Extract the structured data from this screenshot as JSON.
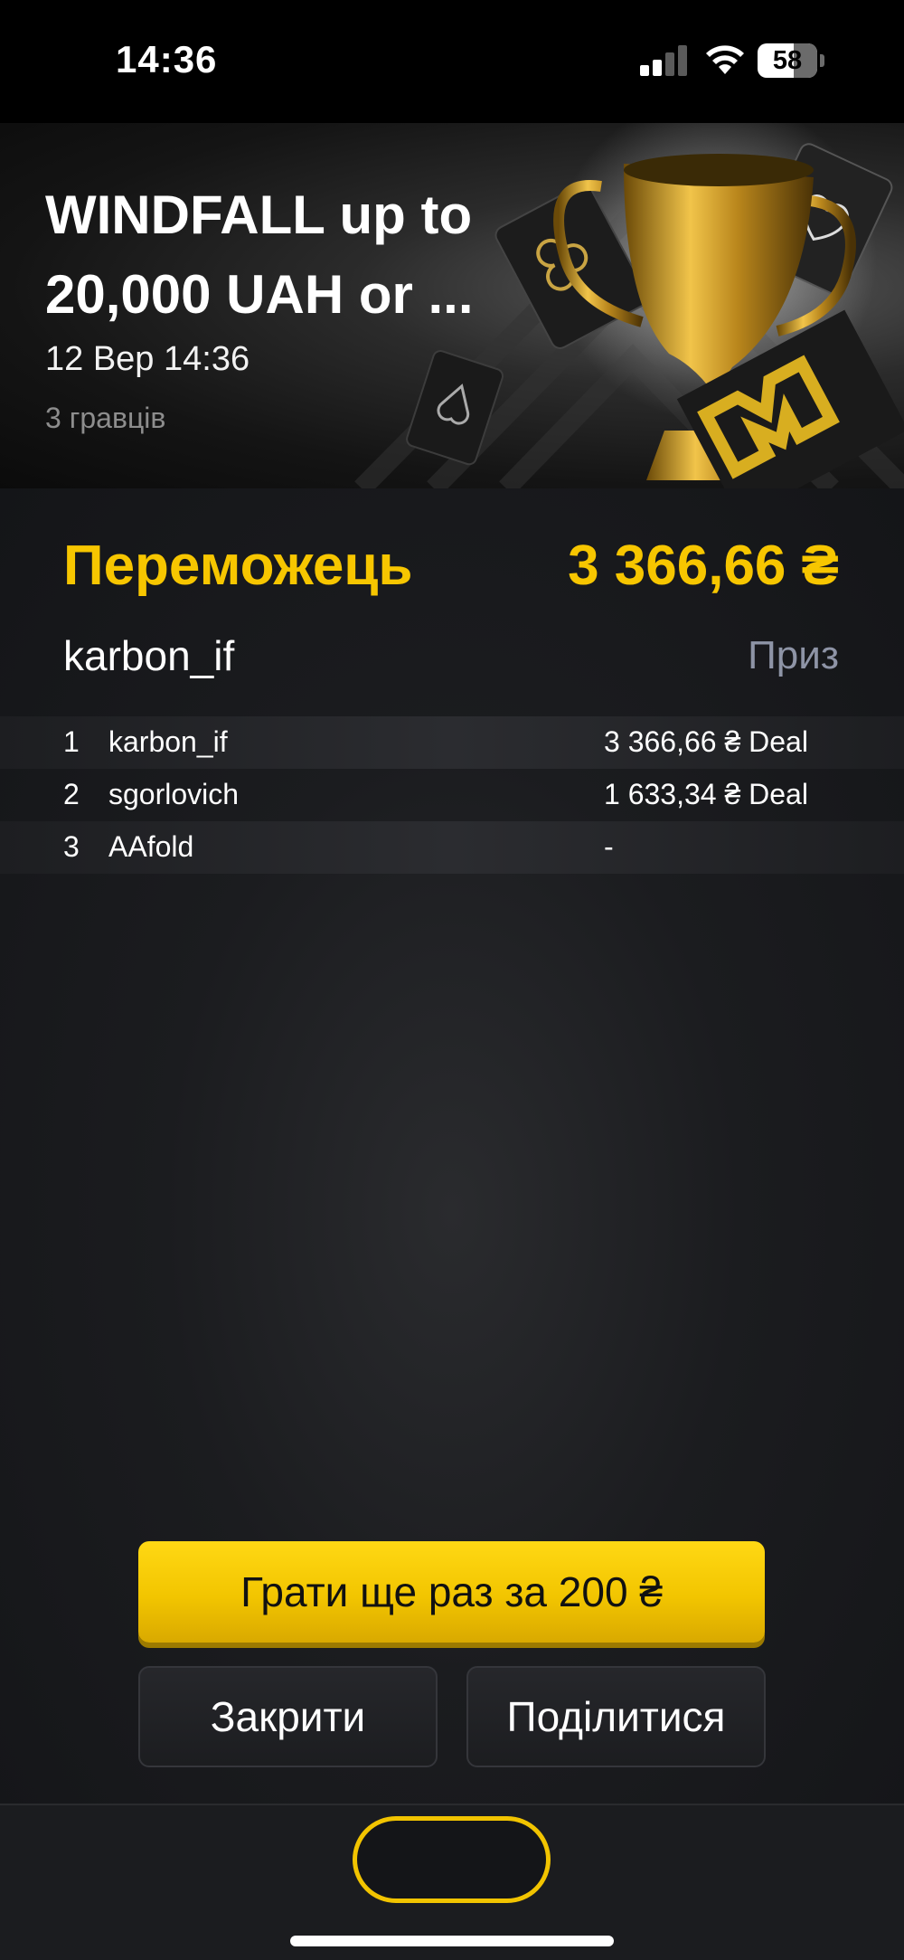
{
  "status_bar": {
    "time": "14:36",
    "battery": "58",
    "signal_icon": "cellular-signal-icon",
    "wifi_icon": "wifi-icon"
  },
  "hero": {
    "title_line1": "WINDFALL up to",
    "title_line2": "20,000 UAH or ...",
    "date": "12 Вер 14:36",
    "players": "3 гравців"
  },
  "winner": {
    "label": "Переможець",
    "amount": "3 366,66 ₴",
    "name": "karbon_if",
    "prize_label": "Приз"
  },
  "results": [
    {
      "pos": "1",
      "name": "karbon_if",
      "prize": "3 366,66 ₴ Deal"
    },
    {
      "pos": "2",
      "name": "sgorlovich",
      "prize": "1 633,34 ₴ Deal"
    },
    {
      "pos": "3",
      "name": "AAfold",
      "prize": "-"
    }
  ],
  "actions": {
    "play_again": "Грати ще раз за 200 ₴",
    "close": "Закрити",
    "share": "Поділитися"
  },
  "colors": {
    "accent": "#f7c600",
    "muted": "#8e94a6",
    "background": "#1b1c1f"
  }
}
